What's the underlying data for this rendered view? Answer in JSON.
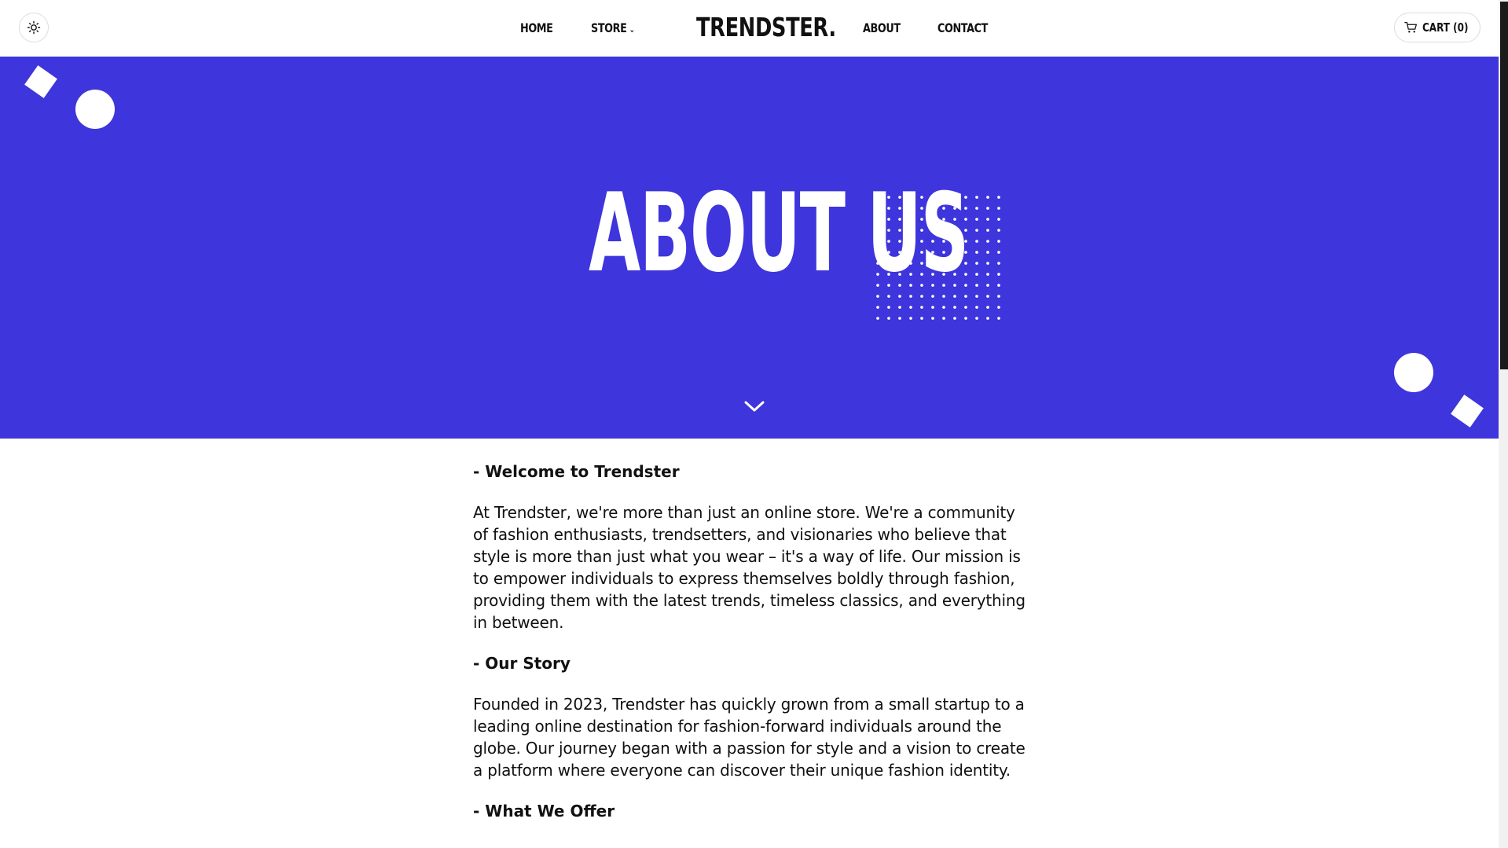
{
  "header": {
    "theme_toggle_icon": "sun-icon",
    "nav": {
      "home": "HOME",
      "store": "STORE",
      "store_chevron": "⌄",
      "about": "ABOUT",
      "contact": "CONTACT"
    },
    "logo": "TRENDSTER.",
    "cart": {
      "label": "CART (0)",
      "icon": "cart-icon"
    }
  },
  "hero": {
    "title": "ABOUT US",
    "accent_color": "#3e35dc",
    "scroll_icon": "chevron-down-icon"
  },
  "content": {
    "sections": [
      {
        "heading": "- Welcome to Trendster",
        "body": "At Trendster, we're more than just an online store. We're a community of fashion enthusiasts, trendsetters, and visionaries who believe that style is more than just what you wear – it's a way of life. Our mission is to empower individuals to express themselves boldly through fashion, providing them with the latest trends, timeless classics, and everything in between."
      },
      {
        "heading": "- Our Story",
        "body": "Founded in 2023, Trendster has quickly grown from a small startup to a leading online destination for fashion-forward individuals around the globe. Our journey began with a passion for style and a vision to create a platform where everyone can discover their unique fashion identity."
      },
      {
        "heading": "- What We Offer"
      }
    ]
  }
}
